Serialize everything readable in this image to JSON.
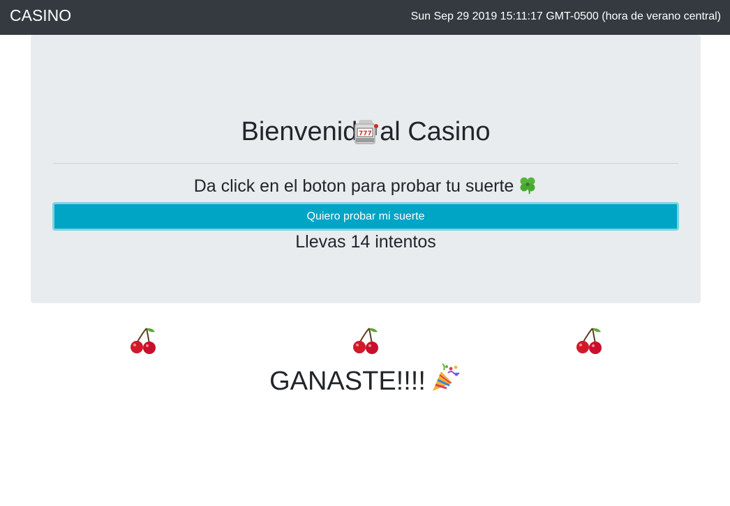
{
  "navbar": {
    "brand": "CASINO",
    "clock": "Sun Sep 29 2019 15:11:17 GMT-0500 (hora de verano central)",
    "background_color": "#343a40"
  },
  "jumbotron": {
    "title": "Bienvenido al Casino",
    "title_icon": "slot-machine-icon",
    "instruction": "Da click en el boton para probar tu suerte",
    "instruction_icon": "four-leaf-clover-icon",
    "button_label": "Quiero probar mi suerte",
    "button_color": "#00a4c4",
    "attempts_text": "Llevas 14 intentos",
    "background_color": "#e9ecef"
  },
  "reels": [
    {
      "symbol": "cherry-icon"
    },
    {
      "symbol": "cherry-icon"
    },
    {
      "symbol": "cherry-icon"
    }
  ],
  "result": {
    "text": "GANASTE!!!!",
    "icon": "party-popper-icon"
  }
}
